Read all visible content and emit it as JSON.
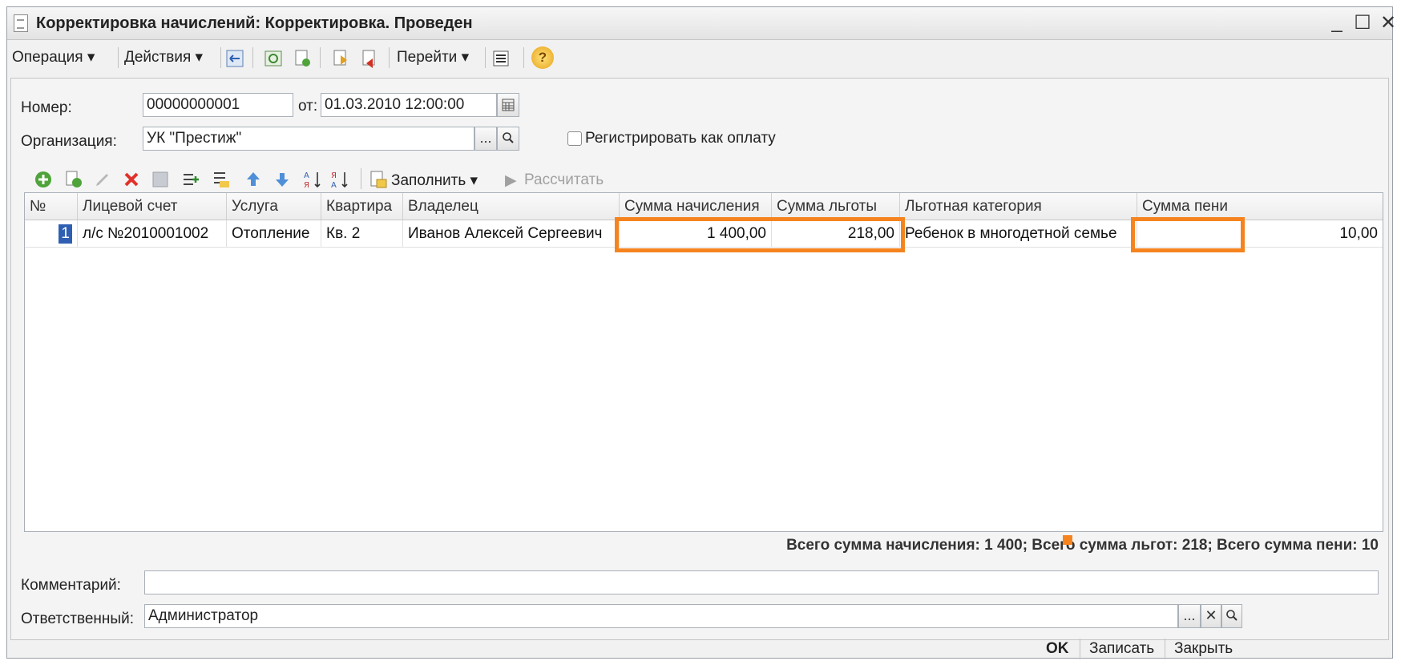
{
  "window": {
    "title": "Корректировка начислений: Корректировка. Проведен",
    "minimize": "_",
    "maximize": "☐",
    "close": "✕"
  },
  "toolbar": {
    "operation": "Операция ▾",
    "actions": "Действия ▾",
    "goto": "Перейти ▾",
    "help": "?"
  },
  "form": {
    "number_label": "Номер:",
    "number_value": "00000000001",
    "date_label": "от:",
    "date_value": "01.03.2010 12:00:00",
    "org_label": "Организация:",
    "org_value": "УК \"Престиж\"",
    "select_btn": "...",
    "register_checkbox_label": "Регистрировать как оплату",
    "register_checked": false
  },
  "grid_toolbar": {
    "fill_label": "Заполнить ▾",
    "calc_label": "Рассчитать"
  },
  "grid": {
    "columns": [
      "№",
      "Лицевой счет",
      "Услуга",
      "Квартира",
      "Владелец",
      "Сумма начисления",
      "Сумма льготы",
      "Льготная категория",
      "Сумма пени"
    ],
    "rows": [
      {
        "n": "1",
        "account": "л/с №2010001002",
        "service": "Отопление",
        "apartment": "Кв. 2",
        "owner": "Иванов Алексей Сергеевич",
        "charge": "1 400,00",
        "benefit": "218,00",
        "category": "Ребенок в многодетной семье",
        "penalty": "10,00"
      }
    ]
  },
  "totals": "Всего сумма начисления: 1 400; Всего сумма льгот: 218; Всего сумма пени: 10",
  "comment_label": "Комментарий:",
  "comment_value": "",
  "responsible_label": "Ответственный:",
  "responsible_value": "Администратор",
  "buttons": {
    "ok": "OK",
    "save": "Записать",
    "close": "Закрыть"
  },
  "colors": {
    "highlight": "#f5841f",
    "row_marker": "#2f5fb3"
  }
}
